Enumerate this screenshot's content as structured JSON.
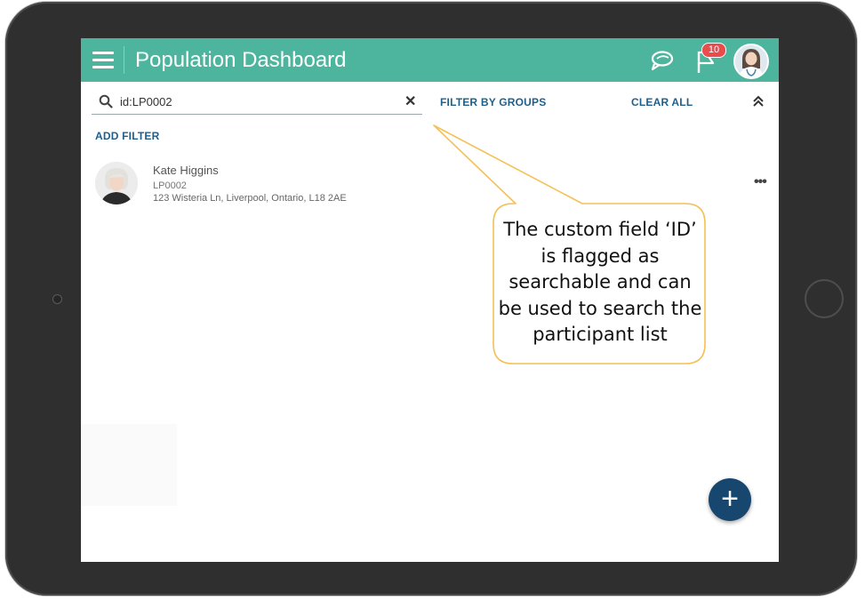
{
  "appbar": {
    "title": "Population Dashboard",
    "menu_icon": "hamburger-menu-icon",
    "chat_icon": "chat-bubbles-icon",
    "flag_icon": "flag-icon",
    "notification_count": "10",
    "accent_color": "#4db59d"
  },
  "search": {
    "value": "id:LP0002",
    "icon": "search-icon",
    "clear_icon": "close-icon"
  },
  "filters": {
    "filter_by_groups": "FILTER BY GROUPS",
    "clear_all": "CLEAR ALL",
    "add_filter": "ADD FILTER",
    "collapse_icon": "double-chevron-up-icon",
    "link_color": "#1f5f8b"
  },
  "participants": [
    {
      "name": "Kate Higgins",
      "id": "LP0002",
      "address": "123 Wisteria Ln, Liverpool, Ontario, L18 2AE"
    }
  ],
  "fab": {
    "icon": "plus-icon",
    "label": "+",
    "color": "#17466f"
  },
  "callout": {
    "text": "The custom field ‘ID’ is flagged as searchable and can be used to search the participant list",
    "border_color": "#f4c158"
  }
}
